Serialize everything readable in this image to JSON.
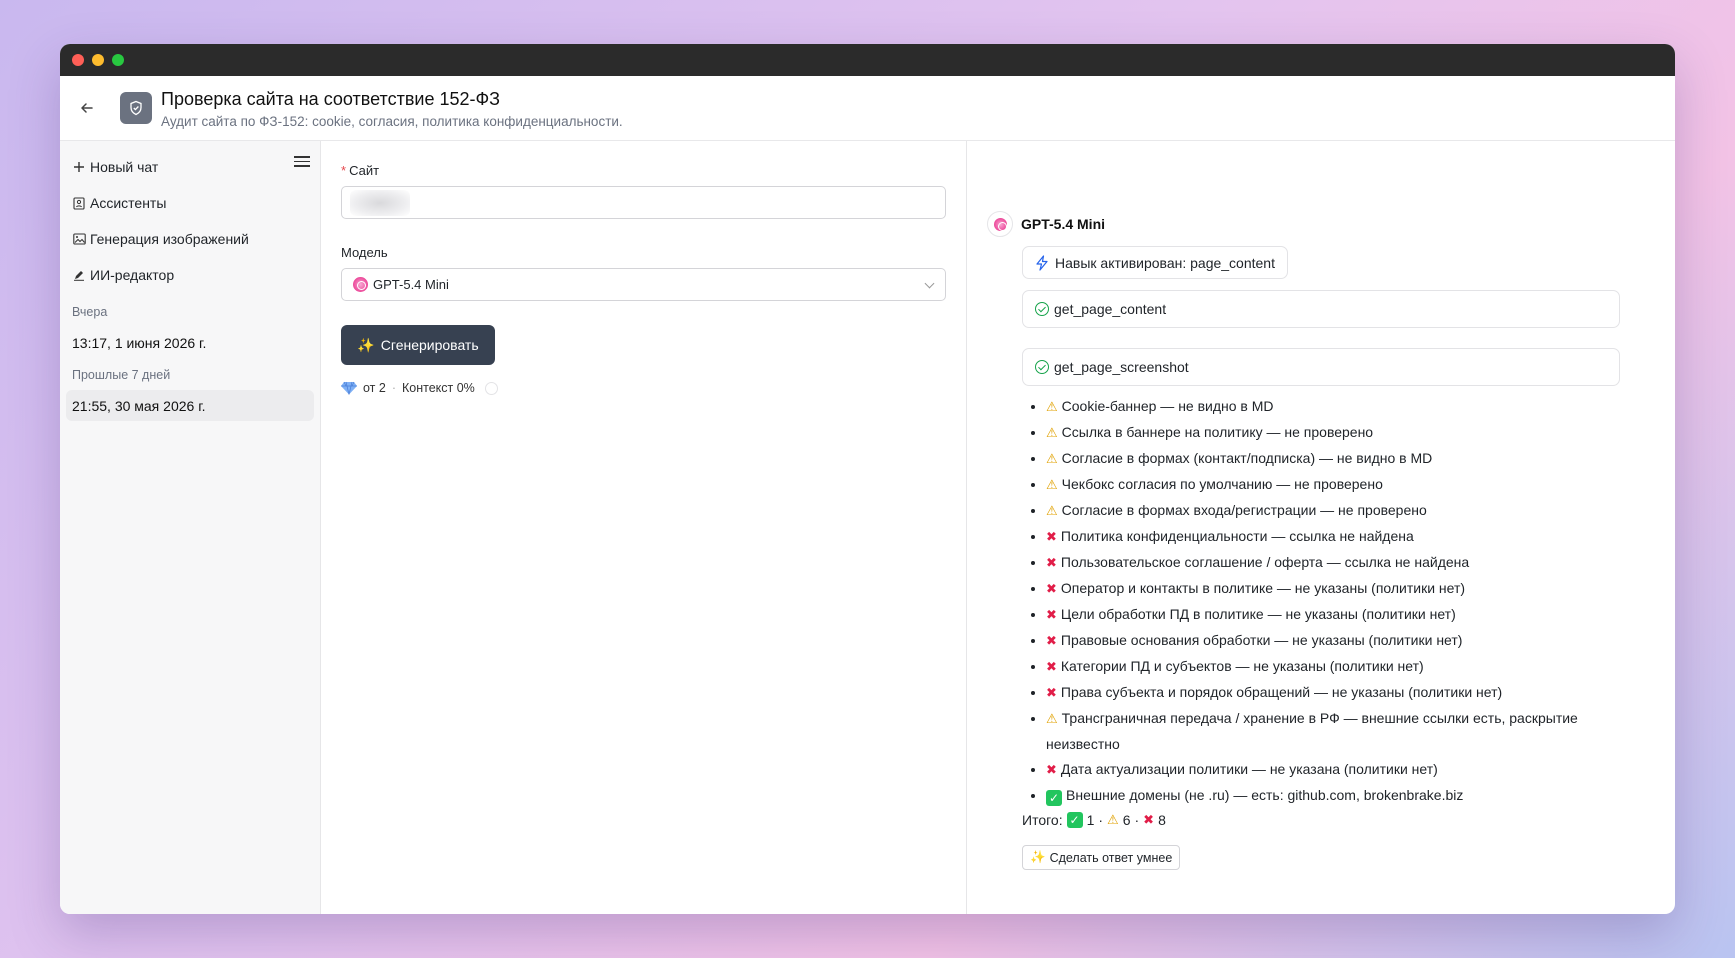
{
  "header": {
    "title": "Проверка сайта на соответствие 152-ФЗ",
    "subtitle": "Аудит сайта по ФЗ-152: cookie, согласия, политика конфиденциальности."
  },
  "sidebar": {
    "new_chat": "Новый чат",
    "items": [
      {
        "label": "Ассистенты",
        "icon": "assistant-icon"
      },
      {
        "label": "Генерация изображений",
        "icon": "image-icon"
      },
      {
        "label": "ИИ-редактор",
        "icon": "pen-icon"
      }
    ],
    "sections": [
      {
        "label": "Вчера",
        "chats": [
          "13:17, 1 июня 2026 г."
        ]
      },
      {
        "label": "Прошлые 7 дней",
        "chats": [
          "21:55, 30 мая 2026 г."
        ]
      }
    ]
  },
  "form": {
    "site_label": "Сайт",
    "site_value": "",
    "model_label": "Модель",
    "model_value": "GPT-5.4 Mini",
    "generate_label": "Сгенерировать",
    "cost": "от 2",
    "separator": "·",
    "context": "Контекст 0%"
  },
  "result": {
    "bot_name": "GPT-5.4 Mini",
    "skill": "Навык активирован: page_content",
    "tools": [
      "get_page_content",
      "get_page_screenshot"
    ],
    "findings": [
      {
        "status": "warn",
        "text": "Cookie-баннер — не видно в MD"
      },
      {
        "status": "warn",
        "text": "Ссылка в баннере на политику — не проверено"
      },
      {
        "status": "warn",
        "text": "Согласие в формах (контакт/подписка) — не видно в MD"
      },
      {
        "status": "warn",
        "text": "Чекбокс согласия по умолчанию — не проверено"
      },
      {
        "status": "warn",
        "text": "Согласие в формах входа/регистрации — не проверено"
      },
      {
        "status": "fail",
        "text": "Политика конфиденциальности — ссылка не найдена"
      },
      {
        "status": "fail",
        "text": "Пользовательское соглашение / оферта — ссылка не найдена"
      },
      {
        "status": "fail",
        "text": "Оператор и контакты в политике — не указаны (политики нет)"
      },
      {
        "status": "fail",
        "text": "Цели обработки ПД в политике — не указаны (политики нет)"
      },
      {
        "status": "fail",
        "text": "Правовые основания обработки — не указаны (политики нет)"
      },
      {
        "status": "fail",
        "text": "Категории ПД и субъектов — не указаны (политики нет)"
      },
      {
        "status": "fail",
        "text": "Права субъекта и порядок обращений — не указаны (политики нет)"
      },
      {
        "status": "warn",
        "text": "Трансграничная передача / хранение в РФ — внешние ссылки есть, раскрытие неизвестно"
      },
      {
        "status": "fail",
        "text": "Дата актуализации политики — не указана (политики нет)"
      },
      {
        "status": "ok",
        "text": "Внешние домены (не .ru) — есть: github.com, brokenbrake.biz"
      }
    ],
    "summary": {
      "label": "Итого:",
      "ok_count": "1",
      "warn_count": "6",
      "fail_count": "8",
      "sep": "·"
    },
    "smart_button": "Сделать ответ умнее"
  },
  "colors": {
    "accent_dark": "#374151",
    "ok": "#22c55e",
    "warn": "#e0a100",
    "fail": "#e11d48"
  }
}
